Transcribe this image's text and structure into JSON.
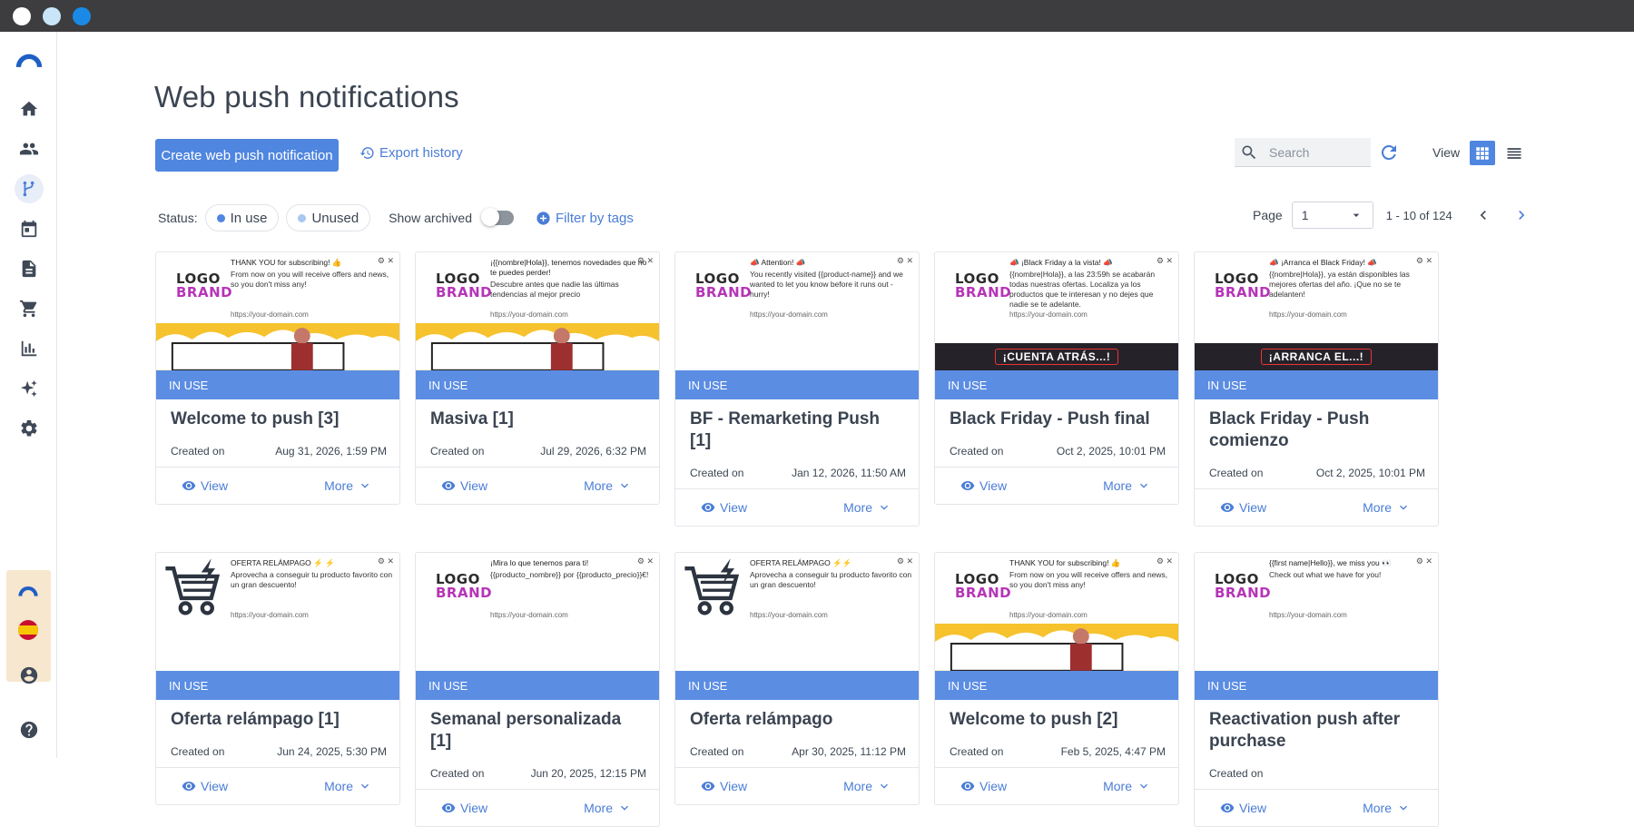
{
  "colors": {
    "accent": "#4f86e0",
    "in_use_badge": "#5b8de3",
    "titlebar": "#3d3d3f",
    "logo_purple": "#b634b8"
  },
  "window": {
    "dots": [
      "#ffffff",
      "#c9e6f8",
      "#1a8ae6"
    ]
  },
  "sidebar": {
    "items": [
      {
        "name": "home-icon"
      },
      {
        "name": "contacts-icon"
      },
      {
        "name": "automation-icon"
      },
      {
        "name": "calendar-icon"
      },
      {
        "name": "document-icon"
      },
      {
        "name": "cart-icon"
      },
      {
        "name": "analytics-icon"
      },
      {
        "name": "sparkles-icon"
      },
      {
        "name": "settings-icon"
      },
      {
        "name": "user-icon"
      },
      {
        "name": "help-icon"
      }
    ]
  },
  "header": {
    "title": "Web push notifications",
    "create_label": "Create web push notification",
    "export_label": "Export history",
    "search_placeholder": "Search",
    "view_label": "View"
  },
  "filters": {
    "status_label": "Status:",
    "in_use_label": "In use",
    "unused_label": "Unused",
    "show_archived_label": "Show archived",
    "filter_tags_label": "Filter by tags"
  },
  "pager": {
    "page_label": "Page",
    "page_value": "1",
    "range": "1 - 10 of 124"
  },
  "card_common": {
    "status": "IN USE",
    "created_label": "Created on",
    "view_label": "View",
    "more_label": "More",
    "logo_line1": "LOGO",
    "logo_line2": "BRAND",
    "url": "https://your-domain.com"
  },
  "cards": [
    {
      "name": "Welcome to push [3]",
      "date": "Aug 31, 2026, 1:59 PM",
      "p_title": "THANK YOU for subscribing! 👍",
      "p_desc": "From now on you will receive offers and news, so you don't miss any!"
    },
    {
      "name": "Masiva [1]",
      "date": "Jul 29, 2026, 6:32 PM",
      "p_title": "¡{{nombre|Hola}}, tenemos novedades que no te puedes perder!",
      "p_desc": "Descubre antes que nadie las últimas tendencias al mejor precio"
    },
    {
      "name": "BF - Remarketing Push [1]",
      "date": "Jan 12, 2026, 11:50 AM",
      "p_title": "📣 Attention! 📣",
      "p_desc": "You recently visited {{product-name}} and we wanted to let you know before it runs out - hurry!"
    },
    {
      "name": "Black Friday - Push final",
      "date": "Oct 2, 2025, 10:01 PM",
      "p_title": "📣 ¡Black Friday a la vista! 📣",
      "p_desc": "{{nombre|Hola}}, a las 23:59h se acabarán todas nuestras ofertas. Localiza ya los productos que te interesan y no dejes que nadie se te adelante.",
      "banner": "¡CUENTA ATRÁS...!"
    },
    {
      "name": "Black Friday - Push comienzo",
      "date": "Oct 2, 2025, 10:01 PM",
      "p_title": "📣 ¡Arranca el Black Friday! 📣",
      "p_desc": "{{nombre|Hola}}, ya están disponibles las mejores ofertas del año. ¡Que no se te adelanten!",
      "banner": "¡ARRANCA EL...!"
    },
    {
      "name": "Oferta relámpago [1]",
      "date": "Jun 24, 2025, 5:30 PM",
      "p_title": "OFERTA RELÁMPAGO ⚡ ⚡",
      "p_desc": "Aprovecha a conseguir tu producto favorito con un gran descuento!"
    },
    {
      "name": "Semanal personalizada [1]",
      "date": "Jun 20, 2025, 12:15 PM",
      "p_title": "¡Mira lo que tenemos para ti!",
      "p_desc": "{{producto_nombre}} por {{producto_precio}}€!"
    },
    {
      "name": "Oferta relámpago",
      "date": "Apr 30, 2025, 11:12 PM",
      "p_title": "OFERTA RELÁMPAGO ⚡⚡",
      "p_desc": "Aprovecha a conseguir tu producto favorito con un gran descuento!"
    },
    {
      "name": "Welcome to push [2]",
      "date": "Feb 5, 2025, 4:47 PM",
      "p_title": "THANK YOU for subscribing! 👍",
      "p_desc": "From now on you will receive offers and news, so you don't miss any!"
    },
    {
      "name": "Reactivation push after purchase",
      "date": "",
      "p_title": "{{first name|Hello}}, we miss you 👀",
      "p_desc": "Check out what we have for you!"
    }
  ]
}
